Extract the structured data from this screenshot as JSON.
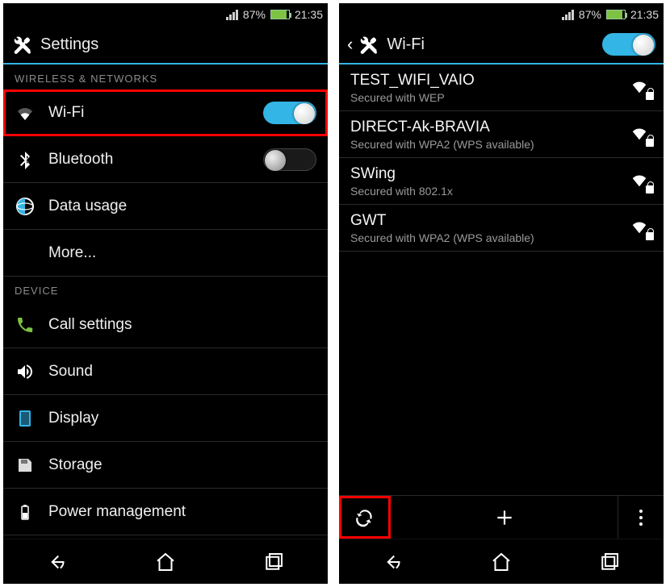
{
  "status": {
    "battery_pct": "87%",
    "time": "21:35"
  },
  "left": {
    "title": "Settings",
    "section_wireless": "WIRELESS & NETWORKS",
    "section_device": "DEVICE",
    "items": {
      "wifi": "Wi-Fi",
      "bluetooth": "Bluetooth",
      "data_usage": "Data usage",
      "more": "More...",
      "call": "Call settings",
      "sound": "Sound",
      "display": "Display",
      "storage": "Storage",
      "power": "Power management"
    },
    "wifi_on": true,
    "bt_on": false
  },
  "right": {
    "title": "Wi-Fi",
    "wifi_on": true,
    "networks": [
      {
        "ssid": "TEST_WIFI_VAIO",
        "desc": "Secured with WEP"
      },
      {
        "ssid": "DIRECT-Ak-BRAVIA",
        "desc": "Secured with WPA2 (WPS available)"
      },
      {
        "ssid": "SWing",
        "desc": "Secured with 802.1x"
      },
      {
        "ssid": "GWT",
        "desc": "Secured with WPA2 (WPS available)"
      }
    ]
  }
}
